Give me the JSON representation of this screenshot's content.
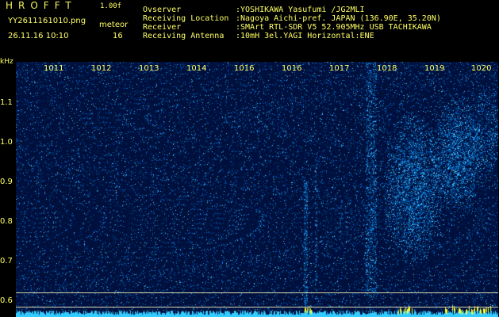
{
  "header": {
    "title": "HROFFT",
    "version": "1.00f",
    "filename": "YY2611161010.png",
    "mode": "meteor",
    "datetime": "26.11.16 10:10",
    "count": "16"
  },
  "info": [
    {
      "label": "Ovserver",
      "value": ":YOSHIKAWA Yasufumi /JG2MLI"
    },
    {
      "label": "Receiving Location",
      "value": ":Nagoya Aichi-pref. JAPAN (136.90E, 35.20N)"
    },
    {
      "label": "Receiver",
      "value": ":SMArt RTL-SDR V5 52.905MHz USB TACHIKAWA"
    },
    {
      "label": "Receiving Antenna",
      "value": ":10mH 3el.YAGI Horizontal:ENE"
    }
  ],
  "axis": {
    "unit": "kHz",
    "time_labels": [
      "1011",
      "1012",
      "1013",
      "1014",
      "1016",
      "1016",
      "1017",
      "1018",
      "1019",
      "1020"
    ],
    "freq_labels": [
      "1.1",
      "1.0",
      "0.9",
      "0.8",
      "0.7",
      "0.6"
    ]
  },
  "colors": {
    "background": "#000000",
    "plot_bg": "#00113a",
    "text": "#ffff66",
    "signal": "#33ccff"
  }
}
